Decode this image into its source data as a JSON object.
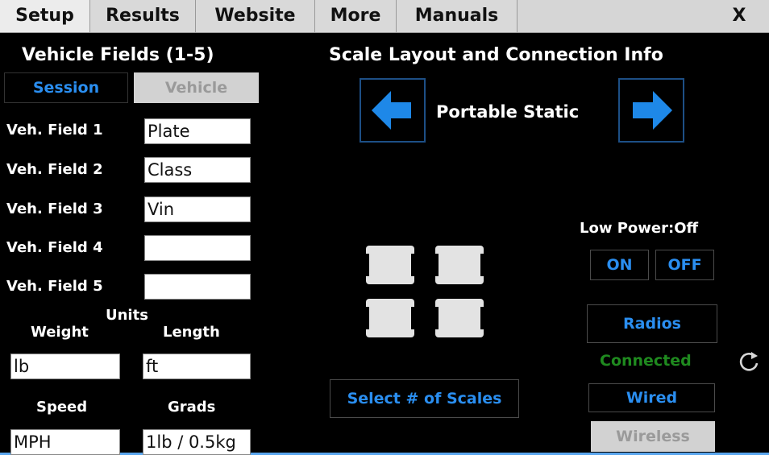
{
  "tabs": [
    {
      "label": "Setup"
    },
    {
      "label": "Results"
    },
    {
      "label": "Website"
    },
    {
      "label": "More"
    },
    {
      "label": "Manuals"
    }
  ],
  "close_label": "X",
  "left": {
    "heading": "Vehicle Fields (1-5)",
    "session_button": "Session",
    "vehicle_button": "Vehicle",
    "fields": [
      {
        "label": "Veh. Field 1",
        "value": "Plate"
      },
      {
        "label": "Veh. Field 2",
        "value": "Class"
      },
      {
        "label": "Veh. Field 3",
        "value": "Vin"
      },
      {
        "label": "Veh. Field 4",
        "value": ""
      },
      {
        "label": "Veh. Field 5",
        "value": ""
      }
    ],
    "units_label": "Units",
    "weight_label": "Weight",
    "length_label": "Length",
    "weight_value": "lb",
    "length_value": "ft",
    "speed_label": "Speed",
    "grads_label": "Grads",
    "speed_value": "MPH",
    "grads_value": "1lb / 0.5kg"
  },
  "right": {
    "heading": "Scale Layout and Connection Info",
    "layout_name": "Portable Static",
    "select_scales_button": "Select # of Scales",
    "low_power_label": "Low Power:Off",
    "on_button": "ON",
    "off_button": "OFF",
    "radios_button": "Radios",
    "status_text": "Connected",
    "wired_button": "Wired",
    "wireless_button": "Wireless"
  },
  "colors": {
    "accent_blue": "#2a8ef0",
    "connected_green": "#1f8a1f",
    "background": "#000000",
    "outer_frame": "#5aa6ee"
  }
}
